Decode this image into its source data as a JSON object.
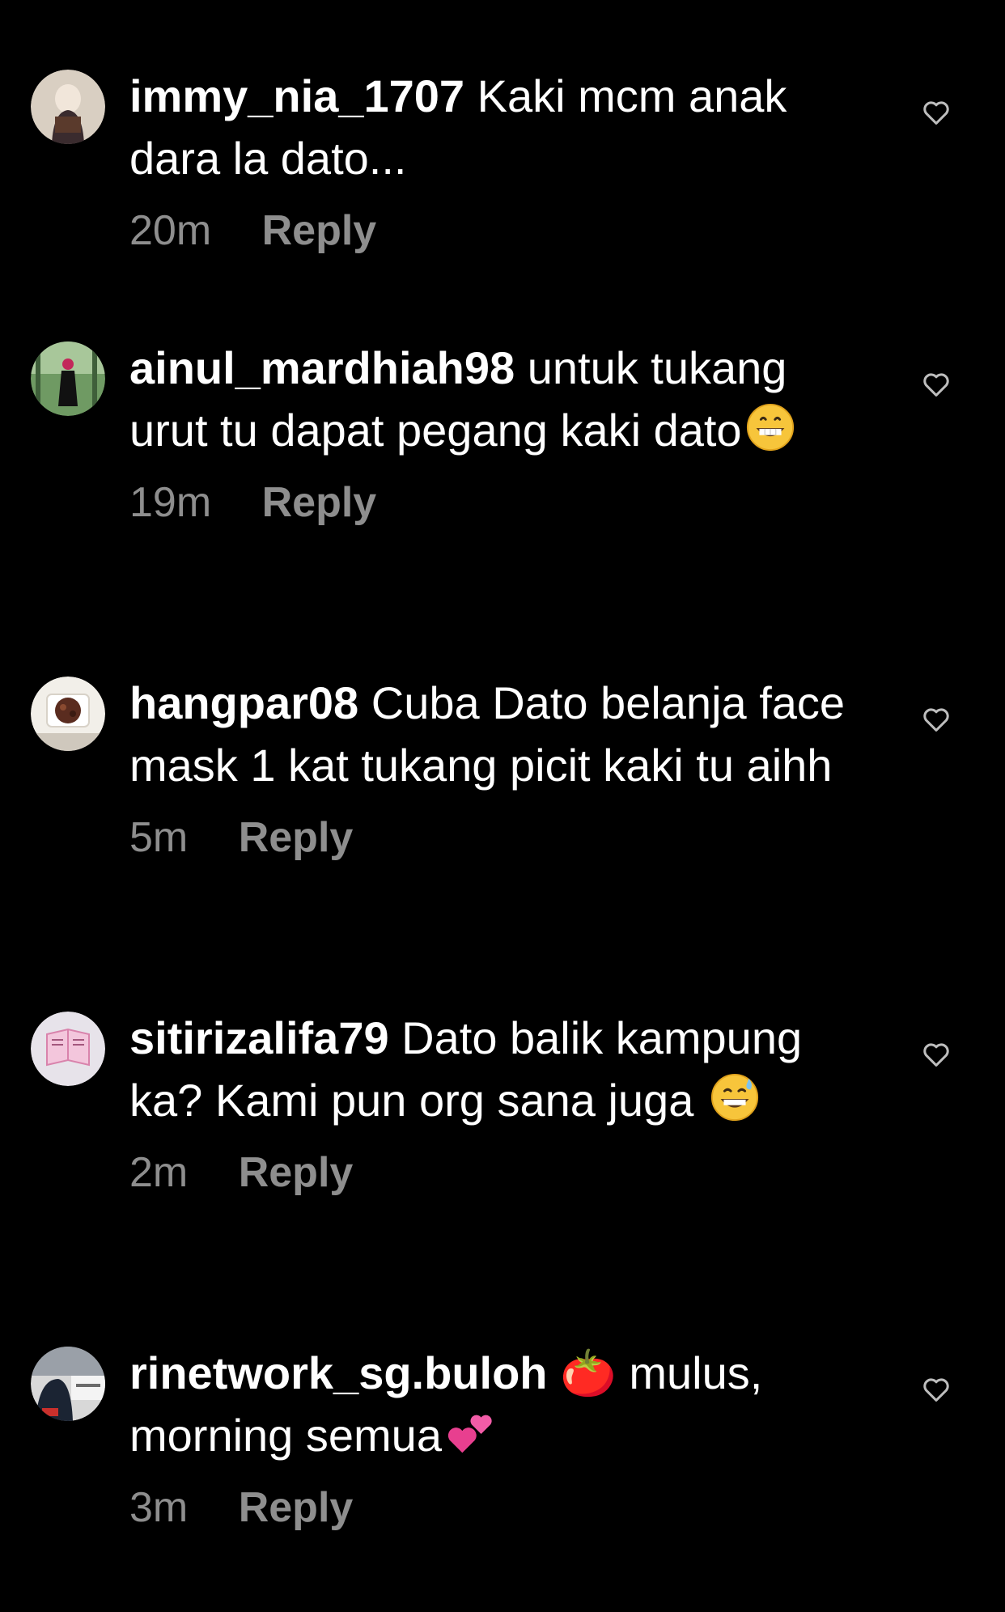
{
  "comments": [
    {
      "username": "immy_nia_1707",
      "text": " Kaki mcm anak dara la dato...",
      "emoji": "",
      "time": "20m",
      "reply_label": "Reply",
      "avatar_colors": [
        "#d9cfc2",
        "#4a3530"
      ]
    },
    {
      "username": "ainul_mardhiah98",
      "text": " untuk tukang urut tu dapat pegang kaki dato",
      "emoji": "grinning-face-emoji",
      "time": "19m",
      "reply_label": "Reply",
      "avatar_colors": [
        "#5f8a57",
        "#c2285a"
      ]
    },
    {
      "username": "hangpar08",
      "text": " Cuba Dato belanja face mask 1 kat tukang picit kaki tu aihh",
      "emoji": "",
      "time": "5m",
      "reply_label": "Reply",
      "avatar_colors": [
        "#f2efe9",
        "#5a2c1f"
      ]
    },
    {
      "username": "sitirizalifa79",
      "text": " Dato balik kampung ka? Kami pun org sana juga ",
      "emoji": "grinning-sweat-emoji",
      "time": "2m",
      "reply_label": "Reply",
      "avatar_colors": [
        "#e7e3ea",
        "#e69ac0"
      ]
    },
    {
      "username": "rinetwork_sg.buloh",
      "text": " 🍅 mulus, morning semua",
      "emoji": "two-hearts-emoji",
      "time": "3m",
      "reply_label": "Reply",
      "avatar_colors": [
        "#d8d8d8",
        "#1b2433"
      ]
    }
  ]
}
